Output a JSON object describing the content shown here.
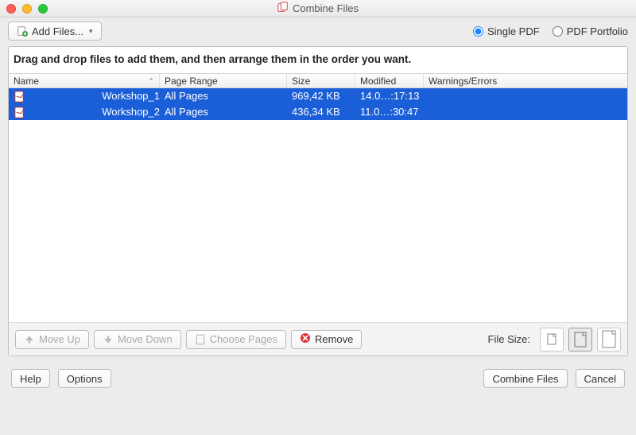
{
  "window": {
    "title": "Combine Files"
  },
  "toolbar": {
    "add_files_label": "Add Files...",
    "output_group": {
      "single_pdf": "Single PDF",
      "pdf_portfolio": "PDF Portfolio"
    }
  },
  "instruction": "Drag and drop files to add them, and then arrange them in the order you want.",
  "columns": {
    "name": "Name",
    "page_range": "Page Range",
    "size": "Size",
    "modified": "Modified",
    "warnings": "Warnings/Errors"
  },
  "rows": [
    {
      "name": "Workshop_1",
      "range": "All Pages",
      "size": "969,42 KB",
      "modified": "14.0…:17:13",
      "warn": ""
    },
    {
      "name": "Workshop_2",
      "range": "All Pages",
      "size": "436,34 KB",
      "modified": "11.0…:30:47",
      "warn": ""
    }
  ],
  "actions": {
    "move_up": "Move Up",
    "move_down": "Move Down",
    "choose_pages": "Choose Pages",
    "remove": "Remove",
    "file_size_label": "File Size:"
  },
  "footer": {
    "help": "Help",
    "options": "Options",
    "combine": "Combine Files",
    "cancel": "Cancel"
  }
}
